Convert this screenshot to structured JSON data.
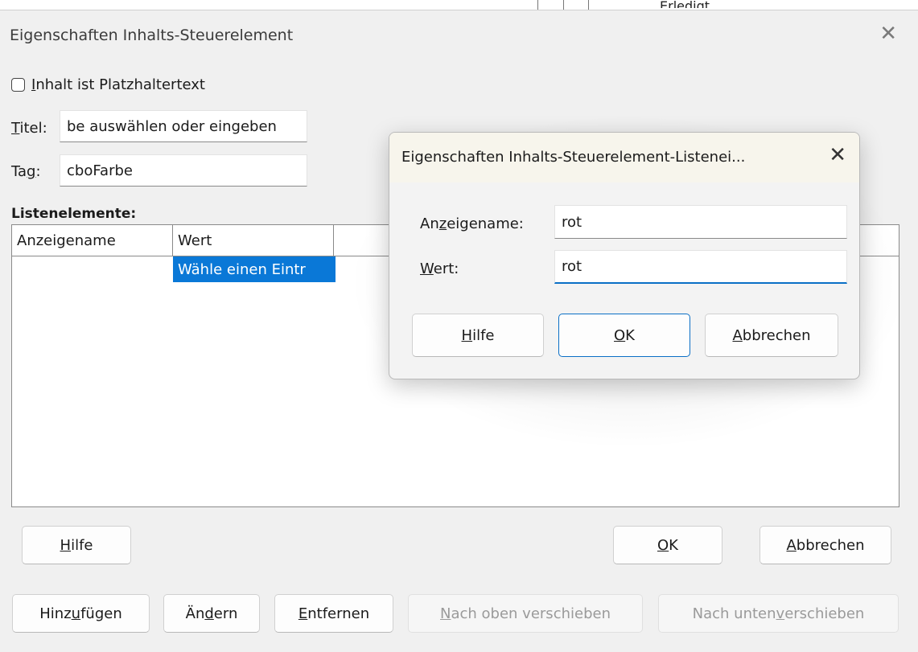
{
  "background": {
    "strip_text": "Erledigt"
  },
  "main_dialog": {
    "title": "Eigenschaften Inhalts-Steuerelement",
    "close_glyph": "✕",
    "checkbox_label_first": "I",
    "checkbox_label_rest": "nhalt ist Platzhaltertext",
    "title_label_first": "T",
    "title_label_rest": "itel:",
    "title_value": "be auswählen oder eingeben",
    "tag_label_first": "Ta",
    "tag_label_u": "g",
    "tag_label_rest": ":",
    "tag_value": "cboFarbe",
    "list_label": "Listenelemente:",
    "list_columns": [
      "Anzeigename",
      "Wert"
    ],
    "list_rows": [
      {
        "display_name": "",
        "value": "Wähle einen Eintr"
      }
    ],
    "help_button": {
      "u": "H",
      "rest": "ilfe"
    },
    "ok_button": {
      "u": "O",
      "rest": "K"
    },
    "cancel_button": {
      "u": "A",
      "rest": "bbrechen"
    },
    "add_button": {
      "pre": "Hinz",
      "u": "u",
      "rest": "fügen"
    },
    "change_button": {
      "pre": "Än",
      "u": "d",
      "rest": "ern"
    },
    "remove_button": {
      "u": "E",
      "rest": "ntfernen"
    },
    "move_up_button": {
      "u": "N",
      "rest": "ach oben verschieben"
    },
    "move_down_button": {
      "pre": "Nach unten ",
      "u": "v",
      "rest": "erschieben"
    }
  },
  "sub_dialog": {
    "title": "Eigenschaften Inhalts-Steuerelement-Listenei...",
    "close_glyph": "✕",
    "display_name_label": {
      "pre": "An",
      "u": "z",
      "rest": "eigename:"
    },
    "display_name_value": "rot",
    "value_label": {
      "u": "W",
      "rest": "ert:"
    },
    "value_value": "rot",
    "help_button": {
      "u": "H",
      "rest": "ilfe"
    },
    "ok_button": {
      "u": "O",
      "rest": "K"
    },
    "cancel_button": {
      "u": "A",
      "rest": "bbrechen"
    }
  }
}
